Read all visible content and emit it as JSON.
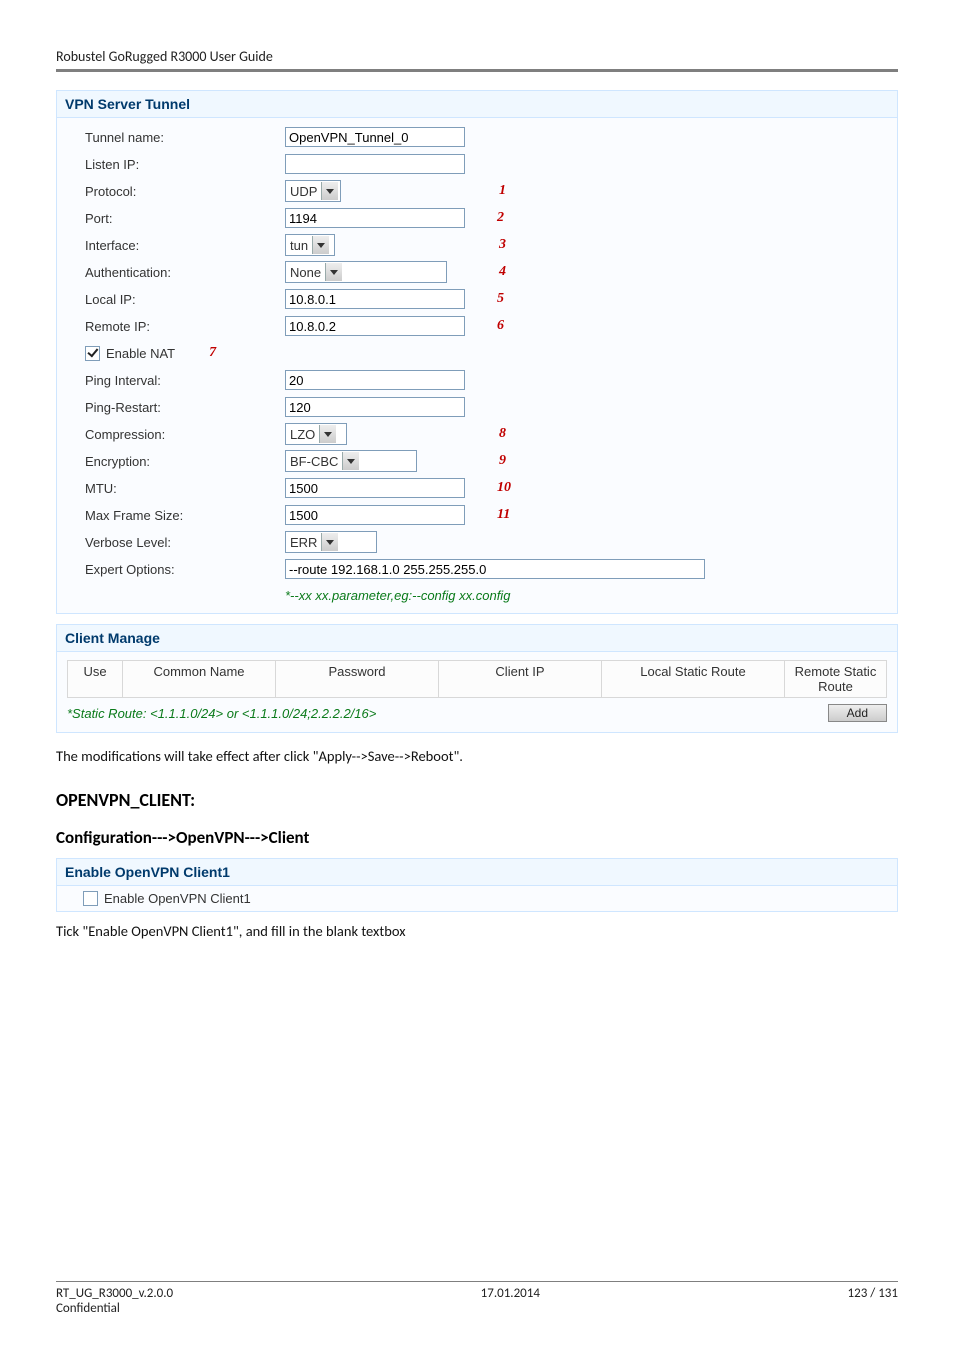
{
  "header": {
    "title": "Robustel GoRugged R3000 User Guide"
  },
  "vpn_panel": {
    "title": "VPN Server Tunnel",
    "fields": {
      "tunnel_name_label": "Tunnel name:",
      "tunnel_name_value": "OpenVPN_Tunnel_0",
      "listen_ip_label": "Listen IP:",
      "listen_ip_value": "",
      "protocol_label": "Protocol:",
      "protocol_value": "UDP",
      "port_label": "Port:",
      "port_value": "1194",
      "interface_label": "Interface:",
      "interface_value": "tun",
      "auth_label": "Authentication:",
      "auth_value": "None",
      "local_ip_label": "Local IP:",
      "local_ip_value": "10.8.0.1",
      "remote_ip_label": "Remote IP:",
      "remote_ip_value": "10.8.0.2",
      "enable_nat_label": "Enable NAT",
      "ping_interval_label": "Ping Interval:",
      "ping_interval_value": "20",
      "ping_restart_label": "Ping-Restart:",
      "ping_restart_value": "120",
      "compression_label": "Compression:",
      "compression_value": "LZO",
      "encryption_label": "Encryption:",
      "encryption_value": "BF-CBC",
      "mtu_label": "MTU:",
      "mtu_value": "1500",
      "max_frame_label": "Max Frame Size:",
      "max_frame_value": "1500",
      "verbose_label": "Verbose Level:",
      "verbose_value": "ERR",
      "expert_label": "Expert Options:",
      "expert_value": "--route 192.168.1.0 255.255.255.0"
    },
    "callouts": {
      "c1": "1",
      "c2": "2",
      "c3": "3",
      "c4": "4",
      "c5": "5",
      "c6": "6",
      "c7": "7",
      "c8": "8",
      "c9": "9",
      "c10": "10",
      "c11": "11"
    },
    "hint": "*--xx xx.parameter,eg:--config xx.config"
  },
  "client_manage": {
    "title": "Client Manage",
    "cols": {
      "use": "Use",
      "common_name": "Common Name",
      "password": "Password",
      "client_ip": "Client IP",
      "local_static": "Local Static Route",
      "remote_static": "Remote Static Route"
    },
    "static_hint": "*Static Route: <1.1.1.0/24> or <1.1.1.0/24;2.2.2.2/16>",
    "add_label": "Add"
  },
  "body": {
    "note1": "The modifications will take effect after click \"Apply-->Save-->Reboot\".",
    "h2": "OPENVPN_CLIENT:",
    "h3": "Configuration--->OpenVPN--->Client",
    "enable_panel_title": "Enable OpenVPN Client1",
    "enable_checkbox_label": "Enable OpenVPN Client1",
    "note2": "Tick \"Enable OpenVPN Client1\", and fill in the blank textbox"
  },
  "footer": {
    "left": "RT_UG_R3000_v.2.0.0",
    "center": "17.01.2014",
    "right": "123 / 131",
    "left2": "Confidential"
  }
}
